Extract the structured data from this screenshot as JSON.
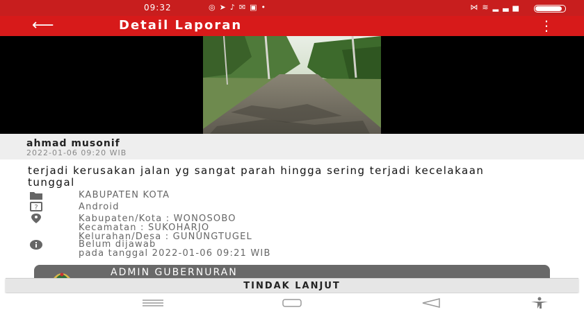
{
  "status_bar": {
    "time": "09:32",
    "left_icons": [
      "whatsapp-icon",
      "telegram-icon",
      "tiktok-icon",
      "gmail-icon",
      "app-icon",
      "dot-icon"
    ],
    "right_icons": [
      "vibrate-icon",
      "wifi-icon",
      "signal-icon",
      "battery-icon"
    ],
    "battery_level": 0.86
  },
  "app_bar": {
    "title": "Detail Laporan",
    "back_icon": "arrow-left-icon",
    "menu_icon": "more-vert-icon"
  },
  "report": {
    "user_name": "ahmad musonif",
    "created_at": "2022-01-06 09:20 WIB",
    "description": "terjadi kerusakan jalan yg sangat parah hingga sering terjadi kecelakaan tunggal",
    "category": "KABUPATEN KOTA",
    "source": "Android",
    "location": {
      "kabupaten": "Kabupaten/Kota : WONOSOBO",
      "kecamatan": "Kecamatan : SUKOHARJO",
      "kelurahan": "Kelurahan/Desa : GUNUNGTUGEL"
    },
    "status": "Belum dijawab",
    "status_date": "pada tanggal 2022-01-06 09:21 WIB"
  },
  "admin": {
    "name": "ADMIN GUBERNURAN"
  },
  "actions": {
    "tindak_lanjut": "TINDAK LANJUT"
  },
  "colors": {
    "accent": "#d71a1a",
    "status_bar": "#c81e1e",
    "admin_card": "#696969"
  }
}
